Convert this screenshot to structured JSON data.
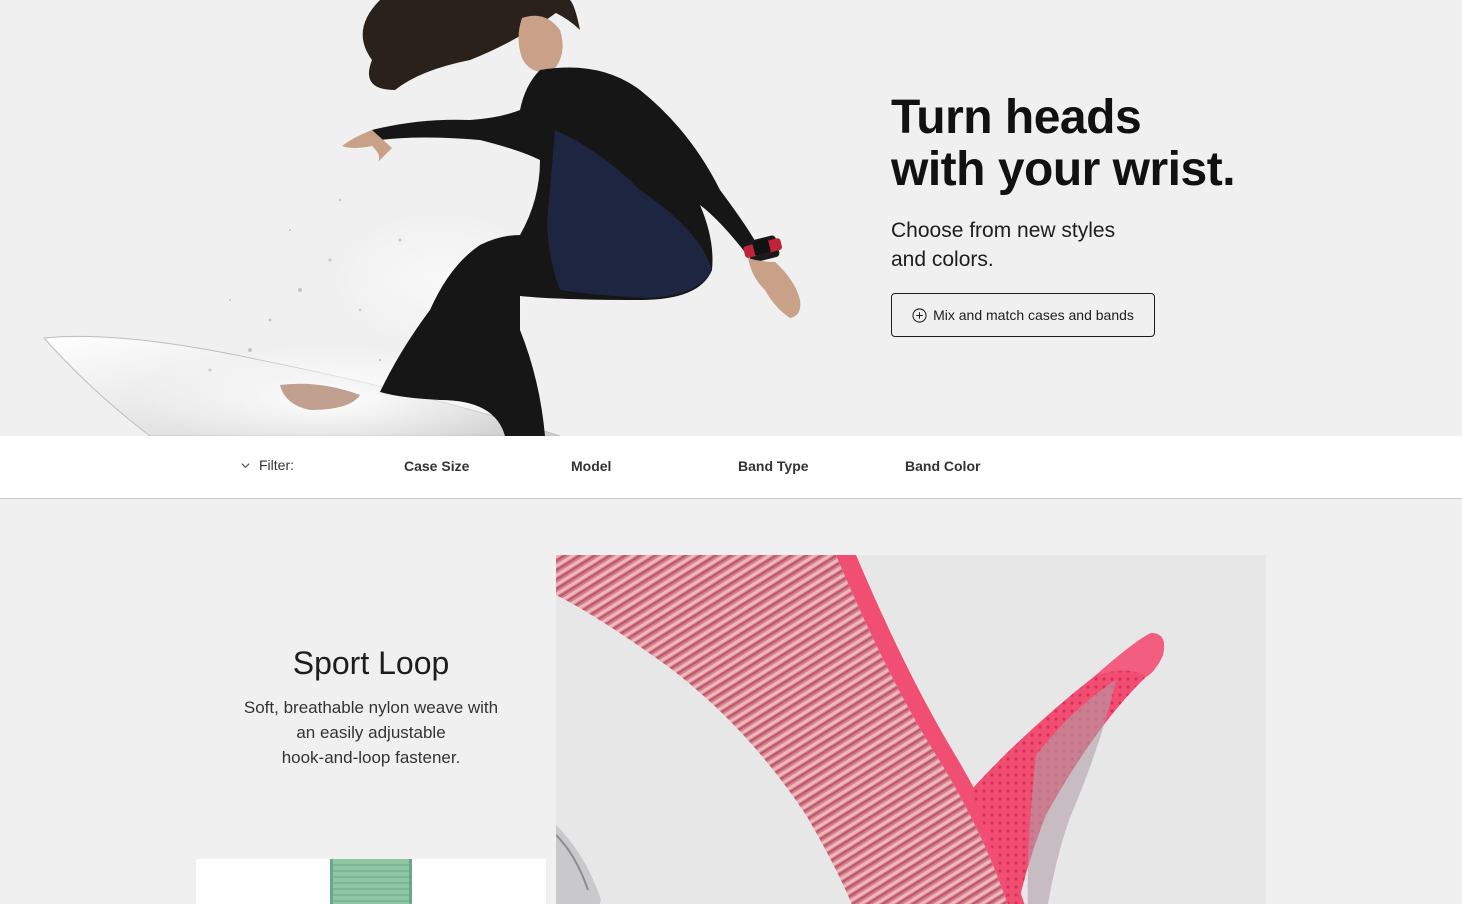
{
  "hero": {
    "headline_line1": "Turn heads",
    "headline_line2": "with your wrist.",
    "sub_line1": "Choose from new styles",
    "sub_line2": "and colors.",
    "cta_label": "Mix and match cases and bands",
    "cta_icon": "plus-circle-icon",
    "image": "surfer-wearing-watch-photo"
  },
  "filter": {
    "label": "Filter:",
    "toggle_icon": "chevron-down-icon",
    "options": [
      "Case Size",
      "Model",
      "Band Type",
      "Band Color"
    ]
  },
  "product": {
    "title": "Sport Loop",
    "desc_line1": "Soft, breathable nylon weave with",
    "desc_line2": "an easily adjustable",
    "desc_line3": "hook-and-loop fastener.",
    "swatch_color": "#8fc7a4",
    "band_color": "#e8446b"
  },
  "colors": {
    "background": "#f0f0f0",
    "text": "#1d1d1f",
    "filter_bar": "#ffffff"
  }
}
